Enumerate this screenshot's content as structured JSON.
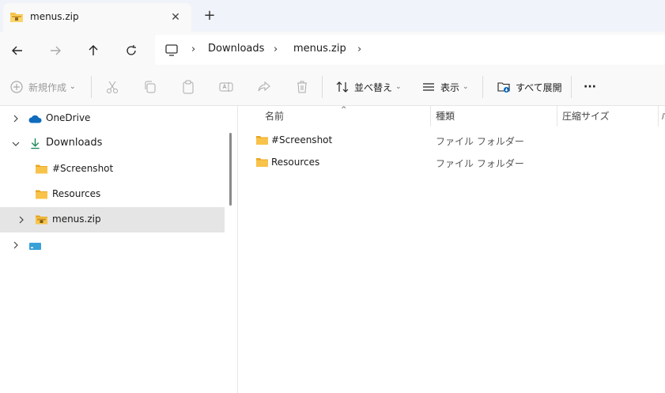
{
  "tab": {
    "title": "menus.zip",
    "close_glyph": "✕",
    "new_tab_glyph": "+"
  },
  "address": {
    "crumbs": [
      "Downloads",
      "menus.zip"
    ],
    "separator": "›"
  },
  "commands": {
    "new": "新規作成",
    "sort": "並べ替え",
    "view": "表示",
    "expand_all": "すべて展開",
    "more": "···"
  },
  "sidebar": {
    "items": [
      {
        "label": "OneDrive"
      },
      {
        "label": "Downloads"
      },
      {
        "label": "#Screenshot"
      },
      {
        "label": "Resources"
      },
      {
        "label": "menus.zip"
      },
      {
        "label": ""
      }
    ]
  },
  "columns": {
    "name": "名前",
    "type": "種類",
    "size": "圧縮サイズ",
    "extra": "ﾊ"
  },
  "rows": [
    {
      "name": "#Screenshot",
      "type": "ファイル フォルダー"
    },
    {
      "name": "Resources",
      "type": "ファイル フォルダー"
    }
  ],
  "colors": {
    "folder": "#f8c34a",
    "onedrive": "#0f6cbd",
    "downloads": "#1b8a5a",
    "accent": "#0067c0"
  },
  "icons": {
    "zip": "zip-folder-icon",
    "folder": "folder-icon",
    "onedrive": "cloud-icon",
    "download": "download-arrow-icon",
    "pc": "monitor-icon"
  }
}
